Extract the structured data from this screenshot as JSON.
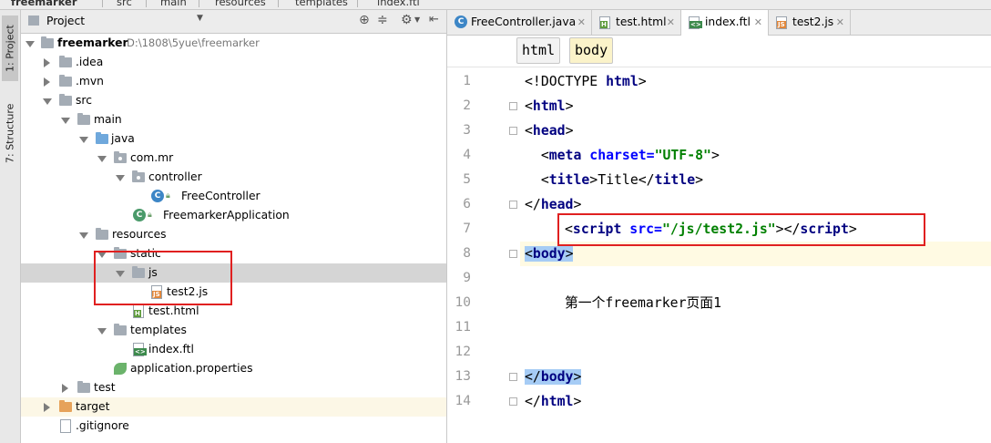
{
  "breadcrumb": [
    "freemarker",
    "src",
    "main",
    "resources",
    "templates",
    "index.ftl"
  ],
  "sidebar_tabs": {
    "project": "1: Project",
    "structure": "7: Structure"
  },
  "project_panel": {
    "title": "Project"
  },
  "tree": [
    {
      "label": "freemarker",
      "path": "D:\\1808\\5yue\\freemarker"
    },
    {
      "label": ".idea"
    },
    {
      "label": ".mvn"
    },
    {
      "label": "src"
    },
    {
      "label": "main"
    },
    {
      "label": "java"
    },
    {
      "label": "com.mr"
    },
    {
      "label": "controller"
    },
    {
      "label": "FreeController"
    },
    {
      "label": "FreemarkerApplication"
    },
    {
      "label": "resources"
    },
    {
      "label": "static"
    },
    {
      "label": "js"
    },
    {
      "label": "test2.js"
    },
    {
      "label": "test.html"
    },
    {
      "label": "templates"
    },
    {
      "label": "index.ftl"
    },
    {
      "label": "application.properties"
    },
    {
      "label": "test"
    },
    {
      "label": "target"
    },
    {
      "label": ".gitignore"
    }
  ],
  "editor_tabs": [
    "FreeController.java",
    "test.html",
    "index.ftl",
    "test2.js"
  ],
  "tag_breadcrumb": [
    "html",
    "body"
  ],
  "code": {
    "line_numbers": [
      "1",
      "2",
      "3",
      "4",
      "5",
      "6",
      "7",
      "8",
      "9",
      "10",
      "11",
      "12",
      "13",
      "14"
    ],
    "l1_a": "<!DOCTYPE ",
    "l1_b": "html",
    "l1_c": ">",
    "l2_a": "<",
    "l2_b": "html",
    "l2_c": ">",
    "l3_a": "<",
    "l3_b": "head",
    "l3_c": ">",
    "l4_a": "  <",
    "l4_b": "meta",
    "l4_c": " ",
    "l4_d": "charset",
    "l4_e": "=",
    "l4_f": "\"UTF-8\"",
    "l4_g": ">",
    "l5_a": "  <",
    "l5_b": "title",
    "l5_c": ">Title</",
    "l5_d": "title",
    "l5_e": ">",
    "l6_a": "</",
    "l6_b": "head",
    "l6_c": ">",
    "l7_a": "<",
    "l7_b": "script",
    "l7_c": " ",
    "l7_d": "src",
    "l7_e": "=",
    "l7_f": "\"/js/test2.js\"",
    "l7_g": "></",
    "l7_h": "script",
    "l7_i": ">",
    "l8_a": "<",
    "l8_b": "body",
    "l8_c": ">",
    "l10": "第一个freemarker页面1",
    "l13_a": "</",
    "l13_b": "body",
    "l13_c": ">",
    "l14_a": "</",
    "l14_b": "html",
    "l14_c": ">"
  },
  "colors": {
    "tag": "#000080",
    "attr": "#0000ff",
    "string": "#008000",
    "highlight": "#a6ccf5",
    "annotation": "#e02020"
  }
}
